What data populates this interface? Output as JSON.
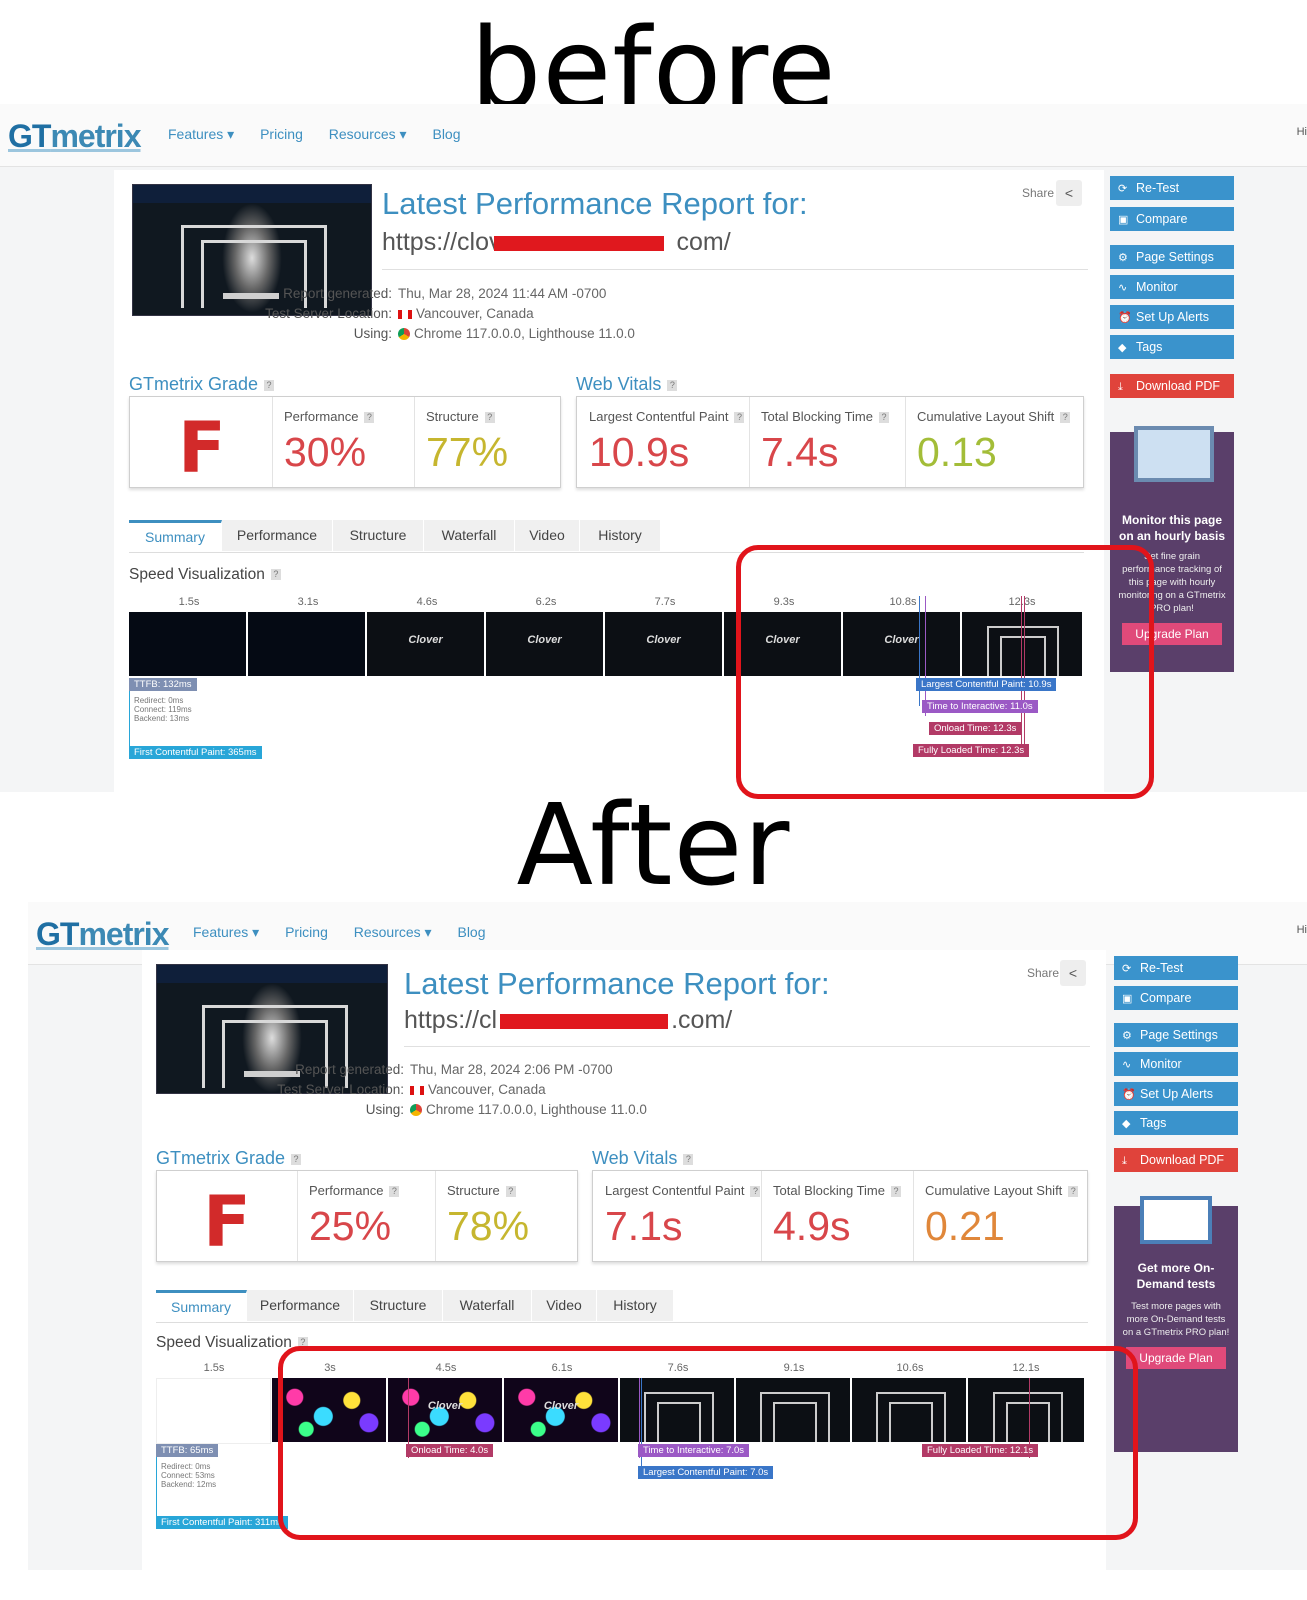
{
  "labels": {
    "before": "before",
    "after": "After"
  },
  "nav": {
    "logo_gt": "GT",
    "logo_rest": "metrix",
    "features": "Features ▾",
    "pricing": "Pricing",
    "resources": "Resources ▾",
    "blog": "Blog",
    "right": "Hi"
  },
  "common": {
    "title": "Latest Performance Report for:",
    "share": "Share",
    "report_generated": "Report generated:",
    "test_server_location": "Test Server Location:",
    "using": "Using:",
    "location": "Vancouver, Canada",
    "browser": "Chrome 117.0.0.0, Lighthouse 11.0.0",
    "grade_heading": "GTmetrix Grade",
    "vitals_heading": "Web Vitals",
    "performance_label": "Performance",
    "structure_label": "Structure",
    "lcp_label": "Largest Contentful Paint",
    "tbt_label": "Total Blocking Time",
    "cls_label": "Cumulative Layout Shift",
    "speed_heading": "Speed Visualization",
    "tabs": [
      "Summary",
      "Performance",
      "Structure",
      "Waterfall",
      "Video",
      "History"
    ],
    "sidebar": [
      "Re-Test",
      "Compare",
      "Page Settings",
      "Monitor",
      "Set Up Alerts",
      "Tags",
      "Download PDF"
    ],
    "thumb_text": "Clover"
  },
  "before": {
    "url_start": "https://clov",
    "url_end": "com/",
    "generated": "Thu, Mar 28, 2024 11:44 AM -0700",
    "grade": "F",
    "performance": "30%",
    "structure": "77%",
    "lcp": "10.9s",
    "tbt": "7.4s",
    "cls": "0.13",
    "ticks": [
      "1.5s",
      "3.1s",
      "4.6s",
      "6.2s",
      "7.7s",
      "9.3s",
      "10.8s",
      "12.3s"
    ],
    "ttfb": "TTFB: 132ms",
    "redirect": "Redirect: 0ms",
    "connect": "Connect: 119ms",
    "backend": "Backend: 13ms",
    "fcp": "First Contentful Paint: 365ms",
    "m_lcp": "Largest Contentful Paint: 10.9s",
    "m_tti": "Time to Interactive: 11.0s",
    "m_onload": "Onload Time: 12.3s",
    "m_fully": "Fully Loaded Time: 12.3s",
    "promo_head": "Monitor this page on an hourly basis",
    "promo_text": "Set fine grain performance tracking of this page with hourly monitoring on a GTmetrix PRO plan!",
    "promo_btn": "Upgrade Plan"
  },
  "after": {
    "url_start": "https://cl",
    "url_end": ".com/",
    "generated": "Thu, Mar 28, 2024 2:06 PM -0700",
    "grade": "F",
    "performance": "25%",
    "structure": "78%",
    "lcp": "7.1s",
    "tbt": "4.9s",
    "cls": "0.21",
    "ticks": [
      "1.5s",
      "3s",
      "4.5s",
      "6.1s",
      "7.6s",
      "9.1s",
      "10.6s",
      "12.1s"
    ],
    "ttfb": "TTFB: 65ms",
    "redirect": "Redirect: 0ms",
    "connect": "Connect: 53ms",
    "backend": "Backend: 12ms",
    "fcp": "First Contentful Paint: 311ms",
    "m_onload": "Onload Time: 4.0s",
    "m_tti": "Time to Interactive: 7.0s",
    "m_lcp": "Largest Contentful Paint: 7.0s",
    "m_fully": "Fully Loaded Time: 12.1s",
    "promo_head": "Get more On-Demand tests",
    "promo_text": "Test more pages with more On-Demand tests on a GTmetrix PRO plan!",
    "promo_btn": "Upgrade Plan"
  },
  "colors": {
    "highlight": "#e1141b",
    "brand": "#3d8fc0",
    "grade_f": "#d22a2a"
  }
}
